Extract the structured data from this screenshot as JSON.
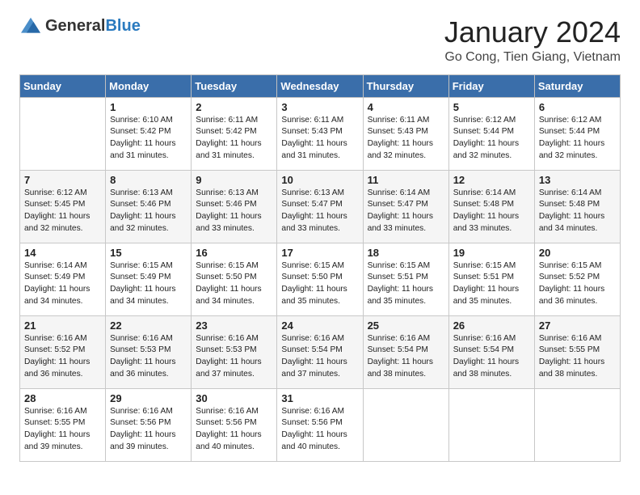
{
  "header": {
    "logo_general": "General",
    "logo_blue": "Blue",
    "month_title": "January 2024",
    "location": "Go Cong, Tien Giang, Vietnam"
  },
  "days_of_week": [
    "Sunday",
    "Monday",
    "Tuesday",
    "Wednesday",
    "Thursday",
    "Friday",
    "Saturday"
  ],
  "weeks": [
    [
      {
        "day": "",
        "info": ""
      },
      {
        "day": "1",
        "info": "Sunrise: 6:10 AM\nSunset: 5:42 PM\nDaylight: 11 hours\nand 31 minutes."
      },
      {
        "day": "2",
        "info": "Sunrise: 6:11 AM\nSunset: 5:42 PM\nDaylight: 11 hours\nand 31 minutes."
      },
      {
        "day": "3",
        "info": "Sunrise: 6:11 AM\nSunset: 5:43 PM\nDaylight: 11 hours\nand 31 minutes."
      },
      {
        "day": "4",
        "info": "Sunrise: 6:11 AM\nSunset: 5:43 PM\nDaylight: 11 hours\nand 32 minutes."
      },
      {
        "day": "5",
        "info": "Sunrise: 6:12 AM\nSunset: 5:44 PM\nDaylight: 11 hours\nand 32 minutes."
      },
      {
        "day": "6",
        "info": "Sunrise: 6:12 AM\nSunset: 5:44 PM\nDaylight: 11 hours\nand 32 minutes."
      }
    ],
    [
      {
        "day": "7",
        "info": "Sunrise: 6:12 AM\nSunset: 5:45 PM\nDaylight: 11 hours\nand 32 minutes."
      },
      {
        "day": "8",
        "info": "Sunrise: 6:13 AM\nSunset: 5:46 PM\nDaylight: 11 hours\nand 32 minutes."
      },
      {
        "day": "9",
        "info": "Sunrise: 6:13 AM\nSunset: 5:46 PM\nDaylight: 11 hours\nand 33 minutes."
      },
      {
        "day": "10",
        "info": "Sunrise: 6:13 AM\nSunset: 5:47 PM\nDaylight: 11 hours\nand 33 minutes."
      },
      {
        "day": "11",
        "info": "Sunrise: 6:14 AM\nSunset: 5:47 PM\nDaylight: 11 hours\nand 33 minutes."
      },
      {
        "day": "12",
        "info": "Sunrise: 6:14 AM\nSunset: 5:48 PM\nDaylight: 11 hours\nand 33 minutes."
      },
      {
        "day": "13",
        "info": "Sunrise: 6:14 AM\nSunset: 5:48 PM\nDaylight: 11 hours\nand 34 minutes."
      }
    ],
    [
      {
        "day": "14",
        "info": "Sunrise: 6:14 AM\nSunset: 5:49 PM\nDaylight: 11 hours\nand 34 minutes."
      },
      {
        "day": "15",
        "info": "Sunrise: 6:15 AM\nSunset: 5:49 PM\nDaylight: 11 hours\nand 34 minutes."
      },
      {
        "day": "16",
        "info": "Sunrise: 6:15 AM\nSunset: 5:50 PM\nDaylight: 11 hours\nand 34 minutes."
      },
      {
        "day": "17",
        "info": "Sunrise: 6:15 AM\nSunset: 5:50 PM\nDaylight: 11 hours\nand 35 minutes."
      },
      {
        "day": "18",
        "info": "Sunrise: 6:15 AM\nSunset: 5:51 PM\nDaylight: 11 hours\nand 35 minutes."
      },
      {
        "day": "19",
        "info": "Sunrise: 6:15 AM\nSunset: 5:51 PM\nDaylight: 11 hours\nand 35 minutes."
      },
      {
        "day": "20",
        "info": "Sunrise: 6:15 AM\nSunset: 5:52 PM\nDaylight: 11 hours\nand 36 minutes."
      }
    ],
    [
      {
        "day": "21",
        "info": "Sunrise: 6:16 AM\nSunset: 5:52 PM\nDaylight: 11 hours\nand 36 minutes."
      },
      {
        "day": "22",
        "info": "Sunrise: 6:16 AM\nSunset: 5:53 PM\nDaylight: 11 hours\nand 36 minutes."
      },
      {
        "day": "23",
        "info": "Sunrise: 6:16 AM\nSunset: 5:53 PM\nDaylight: 11 hours\nand 37 minutes."
      },
      {
        "day": "24",
        "info": "Sunrise: 6:16 AM\nSunset: 5:54 PM\nDaylight: 11 hours\nand 37 minutes."
      },
      {
        "day": "25",
        "info": "Sunrise: 6:16 AM\nSunset: 5:54 PM\nDaylight: 11 hours\nand 38 minutes."
      },
      {
        "day": "26",
        "info": "Sunrise: 6:16 AM\nSunset: 5:54 PM\nDaylight: 11 hours\nand 38 minutes."
      },
      {
        "day": "27",
        "info": "Sunrise: 6:16 AM\nSunset: 5:55 PM\nDaylight: 11 hours\nand 38 minutes."
      }
    ],
    [
      {
        "day": "28",
        "info": "Sunrise: 6:16 AM\nSunset: 5:55 PM\nDaylight: 11 hours\nand 39 minutes."
      },
      {
        "day": "29",
        "info": "Sunrise: 6:16 AM\nSunset: 5:56 PM\nDaylight: 11 hours\nand 39 minutes."
      },
      {
        "day": "30",
        "info": "Sunrise: 6:16 AM\nSunset: 5:56 PM\nDaylight: 11 hours\nand 40 minutes."
      },
      {
        "day": "31",
        "info": "Sunrise: 6:16 AM\nSunset: 5:56 PM\nDaylight: 11 hours\nand 40 minutes."
      },
      {
        "day": "",
        "info": ""
      },
      {
        "day": "",
        "info": ""
      },
      {
        "day": "",
        "info": ""
      }
    ]
  ]
}
